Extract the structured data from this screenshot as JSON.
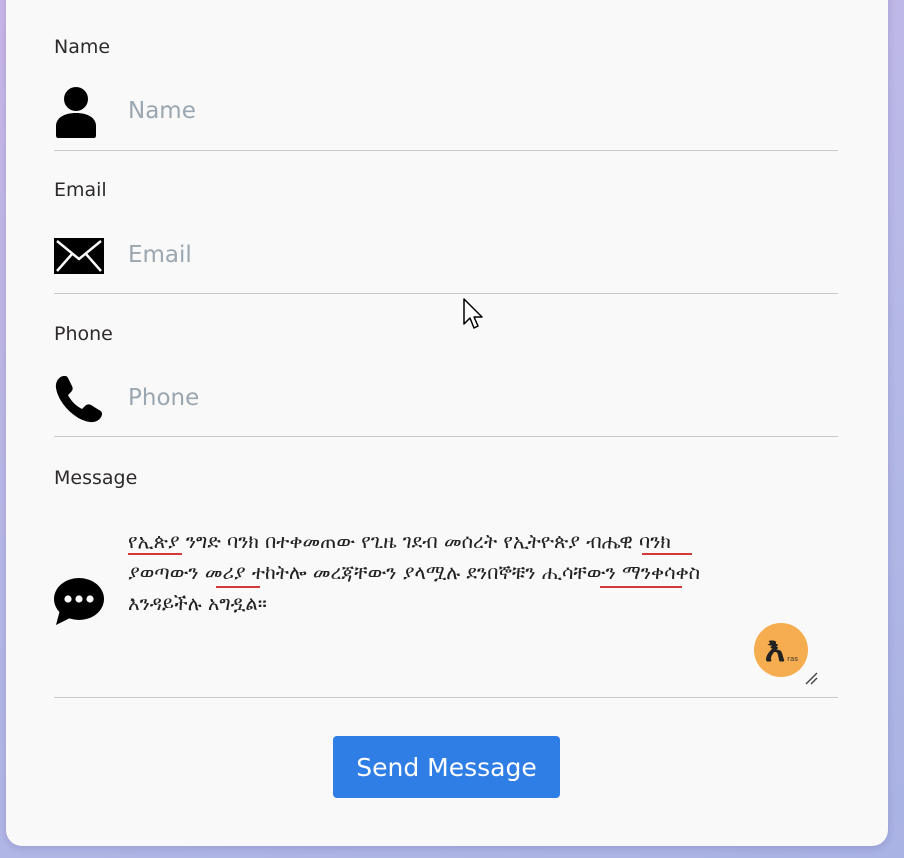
{
  "form": {
    "name": {
      "label": "Name",
      "placeholder": "Name"
    },
    "email": {
      "label": "Email",
      "placeholder": "Email"
    },
    "phone": {
      "label": "Phone",
      "placeholder": "Phone"
    },
    "message": {
      "label": "Message",
      "value": "የኢጵያ ንግድ ባንክ በተቀመጠው የጊዜ ገደብ መሰረት የኢትዮጵያ ብሔዊ ባንክ\nያወጣውን መሪያ ተከትሎ መረጃቸውን ያላሟሉ ደንበኞቹን  ሒሳቸውን ማንቀሳቀስ\nእንዳይችሉ አግዷል።"
    },
    "submit_label": "Send Message"
  },
  "extension_badge": {
    "glyph": "እ",
    "sub": "ras"
  },
  "icons": [
    "user-icon",
    "envelope-icon",
    "phone-icon",
    "chat-bubble-icon",
    "resize-handle-icon",
    "mouse-cursor-icon"
  ],
  "colors": {
    "button": "#2e7ee6",
    "badge": "#f6ad4f",
    "spellcheck": "#d23a3a"
  }
}
